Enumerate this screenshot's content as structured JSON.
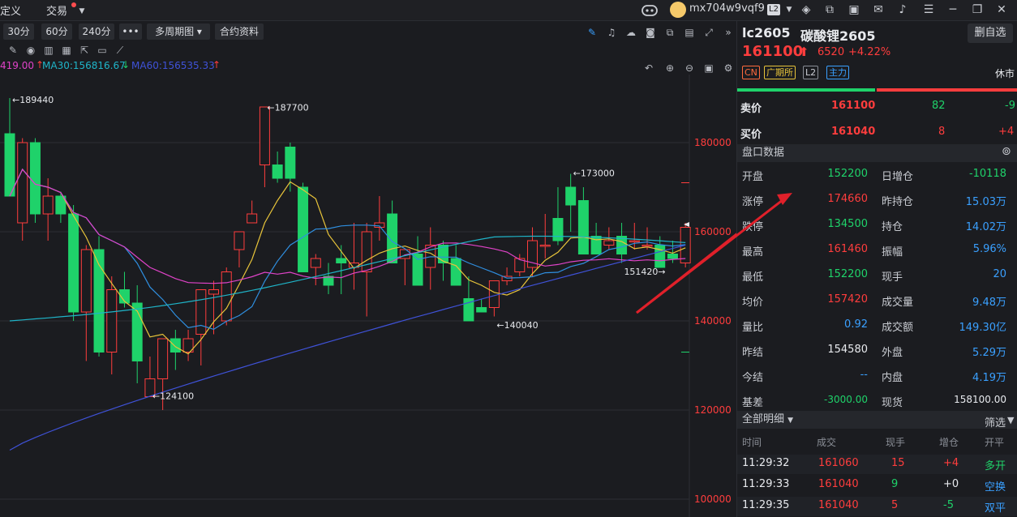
{
  "topbar": {
    "menu_custom": "定义",
    "menu_trade": "交易",
    "username": "mx704w9vqf9",
    "level_badge": "L2"
  },
  "toolbar": {
    "periods": [
      "30分",
      "60分",
      "240分"
    ],
    "more": "•••",
    "multi_period": "多周期图",
    "contract_info": "合约资料"
  },
  "ma": {
    "ma_partial": "419.00",
    "ma30": "MA30:156816.67",
    "ma60": "MA60:156535.33"
  },
  "chart_data": {
    "type": "candlestick",
    "title": "",
    "y_axis_ticks": [
      "180000",
      "160000",
      "140000",
      "120000",
      "100000"
    ],
    "ylim": [
      100000,
      190000
    ],
    "annotations": [
      {
        "label": "189440",
        "kind": "high"
      },
      {
        "label": "187700",
        "kind": "high"
      },
      {
        "label": "173000",
        "kind": "high"
      },
      {
        "label": "124100",
        "kind": "low"
      },
      {
        "label": "140040",
        "kind": "low"
      },
      {
        "label": "151420",
        "kind": "low"
      }
    ],
    "candles": [
      [
        182000,
        190000,
        168000,
        168000
      ],
      [
        162000,
        181000,
        158000,
        180000
      ],
      [
        180000,
        181000,
        162000,
        164000
      ],
      [
        164000,
        172000,
        158000,
        168000
      ],
      [
        168000,
        169000,
        162000,
        164000
      ],
      [
        164000,
        166000,
        140000,
        142000
      ],
      [
        142000,
        157000,
        131000,
        156000
      ],
      [
        156000,
        159000,
        132000,
        133000
      ],
      [
        133000,
        150000,
        128000,
        147000
      ],
      [
        147000,
        151000,
        143000,
        144000
      ],
      [
        144000,
        148000,
        126000,
        131000
      ],
      [
        123000,
        132000,
        124000,
        127000
      ],
      [
        127000,
        136000,
        120000,
        136000
      ],
      [
        136000,
        138000,
        129000,
        133000
      ],
      [
        133000,
        138000,
        131000,
        136000
      ],
      [
        137000,
        147000,
        130000,
        147000
      ],
      [
        146000,
        149000,
        137000,
        147000
      ],
      [
        140000,
        152000,
        139000,
        151000
      ],
      [
        156000,
        160000,
        152000,
        160000
      ],
      [
        162000,
        167000,
        162000,
        164000
      ],
      [
        175000,
        188000,
        170000,
        188000
      ],
      [
        175000,
        178000,
        171000,
        172000
      ],
      [
        179000,
        180000,
        169000,
        172000
      ],
      [
        170000,
        171000,
        151000,
        151000
      ],
      [
        152000,
        155000,
        148000,
        154000
      ],
      [
        150000,
        153000,
        146000,
        148000
      ],
      [
        154000,
        157000,
        146000,
        153000
      ],
      [
        152000,
        162000,
        147000,
        153000
      ],
      [
        151000,
        162000,
        141000,
        160000
      ],
      [
        161000,
        168000,
        158000,
        162000
      ],
      [
        164000,
        167000,
        153000,
        153000
      ],
      [
        154000,
        156000,
        148000,
        156000
      ],
      [
        155000,
        159000,
        148000,
        148000
      ],
      [
        152000,
        161000,
        147000,
        157000
      ],
      [
        157000,
        158000,
        149000,
        153000
      ],
      [
        154000,
        157000,
        148000,
        148000
      ],
      [
        145000,
        150000,
        140000,
        140000
      ],
      [
        143000,
        145000,
        142000,
        142000
      ],
      [
        143000,
        149000,
        141000,
        149000
      ],
      [
        149000,
        152000,
        148000,
        150000
      ],
      [
        151000,
        155000,
        150000,
        154000
      ],
      [
        152000,
        161000,
        150000,
        158000
      ],
      [
        157000,
        164000,
        154000,
        157000
      ],
      [
        163000,
        170000,
        157000,
        158000
      ],
      [
        170000,
        173000,
        160000,
        166000
      ],
      [
        167000,
        170000,
        155000,
        155000
      ],
      [
        159000,
        162000,
        155000,
        155000
      ],
      [
        157000,
        161000,
        156000,
        158000
      ],
      [
        159000,
        162000,
        153000,
        155000
      ],
      [
        158000,
        162000,
        156000,
        158000
      ],
      [
        157000,
        161000,
        156000,
        157000
      ],
      [
        157000,
        159000,
        152000,
        152000
      ],
      [
        155000,
        158000,
        153000,
        154000
      ],
      [
        153000,
        162000,
        152000,
        161000
      ]
    ]
  },
  "panel": {
    "symbol": "lc2605",
    "name": "碳酸锂2605",
    "delete_btn": "删自选",
    "last_price": "161100",
    "change": "6520",
    "change_pct": "+4.22%",
    "tags": [
      "CN",
      "广期所",
      "L2",
      "主力"
    ],
    "session": "休市",
    "ask_label": "卖价",
    "ask_price": "161100",
    "ask_vol": "82",
    "ask_chg": "-9",
    "bid_label": "买价",
    "bid_price": "161040",
    "bid_vol": "8",
    "bid_chg": "+4",
    "quote_header": "盘口数据",
    "quotes_left": [
      {
        "label": "开盘",
        "value": "152200",
        "color": "green"
      },
      {
        "label": "涨停",
        "value": "174660",
        "color": "red"
      },
      {
        "label": "跌停",
        "value": "134500",
        "color": "green"
      },
      {
        "label": "最高",
        "value": "161460",
        "color": "red"
      },
      {
        "label": "最低",
        "value": "152200",
        "color": "green"
      },
      {
        "label": "均价",
        "value": "157420",
        "color": "red"
      },
      {
        "label": "量比",
        "value": "0.92",
        "color": "blue"
      },
      {
        "label": "昨结",
        "value": "154580",
        "color": "white"
      },
      {
        "label": "今结",
        "value": "--",
        "color": "blue"
      },
      {
        "label": "基差",
        "value": "-3000.00",
        "color": "green"
      }
    ],
    "quotes_right": [
      {
        "label": "日增仓",
        "value": "-10118",
        "color": "green"
      },
      {
        "label": "昨持仓",
        "value": "15.03万",
        "color": "blue"
      },
      {
        "label": "持仓",
        "value": "14.02万",
        "color": "blue"
      },
      {
        "label": "振幅",
        "value": "5.96%",
        "color": "blue"
      },
      {
        "label": "现手",
        "value": "20",
        "color": "blue"
      },
      {
        "label": "成交量",
        "value": "9.48万",
        "color": "blue"
      },
      {
        "label": "成交额",
        "value": "149.30亿",
        "color": "blue"
      },
      {
        "label": "外盘",
        "value": "5.29万",
        "color": "blue"
      },
      {
        "label": "内盘",
        "value": "4.19万",
        "color": "blue"
      },
      {
        "label": "现货",
        "value": "158100.00",
        "color": "white"
      }
    ],
    "detail_header": "全部明细",
    "filter": "筛选",
    "detail_cols": [
      "时间",
      "成交",
      "现手",
      "增仓",
      "开平"
    ],
    "details": [
      {
        "time": "11:29:32",
        "price": "161060",
        "vol": "15",
        "oi": "+4",
        "type": "多开"
      },
      {
        "time": "11:29:33",
        "price": "161040",
        "vol": "9",
        "oi": "+0",
        "type": "空换"
      },
      {
        "time": "11:29:35",
        "price": "161040",
        "vol": "5",
        "oi": "-5",
        "type": "双平"
      }
    ]
  },
  "colors": {
    "up": "#ff3d3d",
    "down": "#1fd26a",
    "ma30": "#1fb4c8",
    "ma60": "#3f52d8",
    "ma_yellow": "#e8c43a",
    "ma_magenta": "#e043c8",
    "arrow": "#e0202a",
    "background": "#1b1c20"
  }
}
